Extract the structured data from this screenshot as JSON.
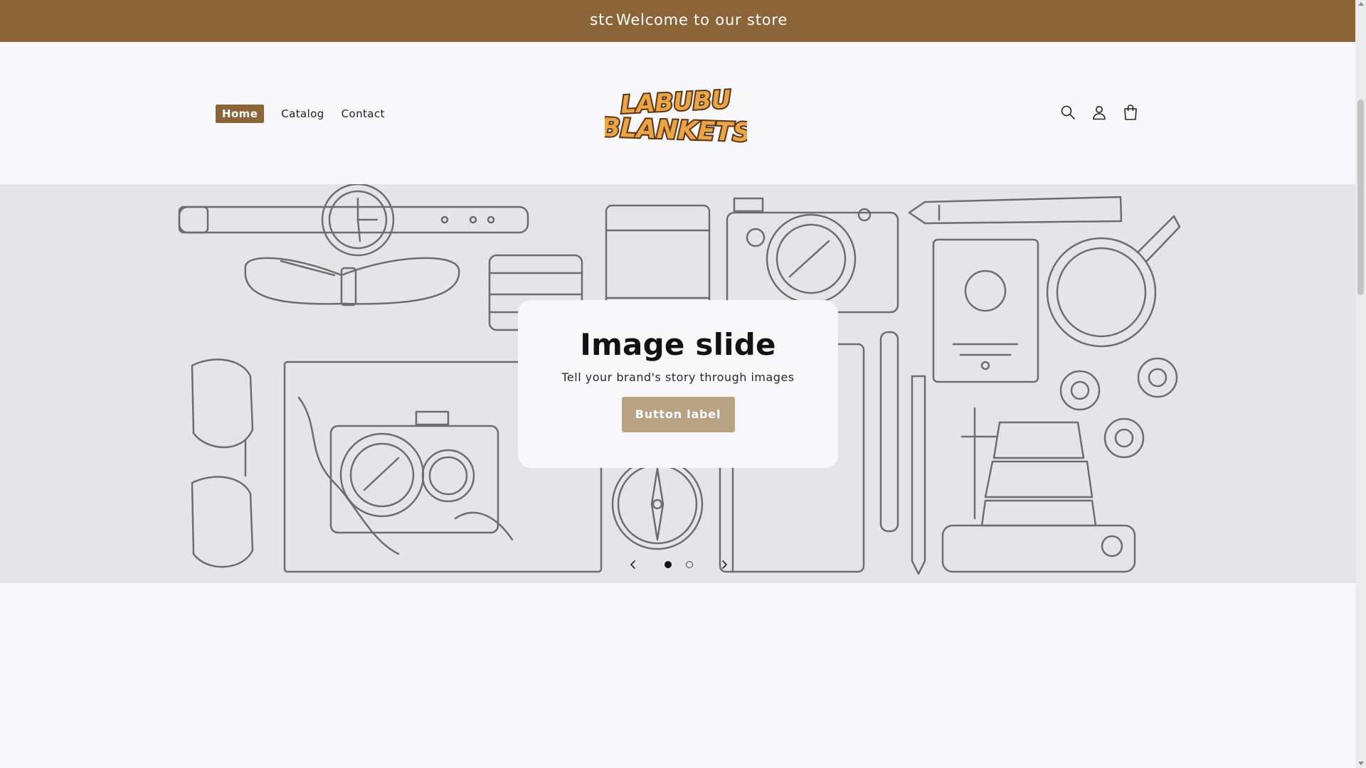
{
  "announcement": {
    "ghost_text": "stc",
    "message": "Welcome to our store"
  },
  "nav": {
    "items": [
      {
        "label": "Home",
        "active": true
      },
      {
        "label": "Catalog",
        "active": false
      },
      {
        "label": "Contact",
        "active": false
      }
    ]
  },
  "logo": {
    "line1": "LABUBU",
    "line2": "BLANKETS"
  },
  "header_icons": [
    "search-icon",
    "account-icon",
    "cart-icon"
  ],
  "slideshow": {
    "heading": "Image slide",
    "subheading": "Tell your brand's story through images",
    "button_label": "Button label",
    "total_slides": 2,
    "current_slide": 1
  },
  "colors": {
    "announcement_bg": "#8b6537",
    "accent": "#8b6537",
    "button_bg": "#b9a385",
    "logo_fill": "#e9a443",
    "logo_stroke": "#5b3418"
  }
}
